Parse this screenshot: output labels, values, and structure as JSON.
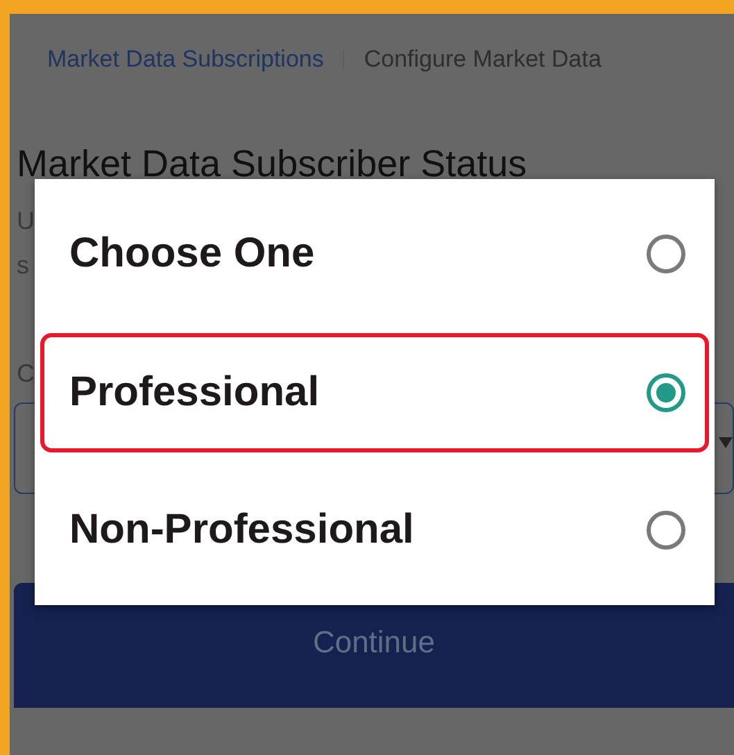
{
  "breadcrumb": [
    {
      "label": "Market Data Subscriptions",
      "kind": "link"
    },
    {
      "label": "Configure Market Data",
      "kind": "current"
    }
  ],
  "heading": "Market Data Subscriber Status",
  "description_lines": [
    "U",
    "s"
  ],
  "field_label": "C",
  "continue_button": "Continue",
  "dialog": {
    "options": [
      {
        "label": "Choose One",
        "selected": false,
        "highlighted": false
      },
      {
        "label": "Professional",
        "selected": true,
        "highlighted": true
      },
      {
        "label": "Non-Professional",
        "selected": false,
        "highlighted": false
      }
    ]
  }
}
